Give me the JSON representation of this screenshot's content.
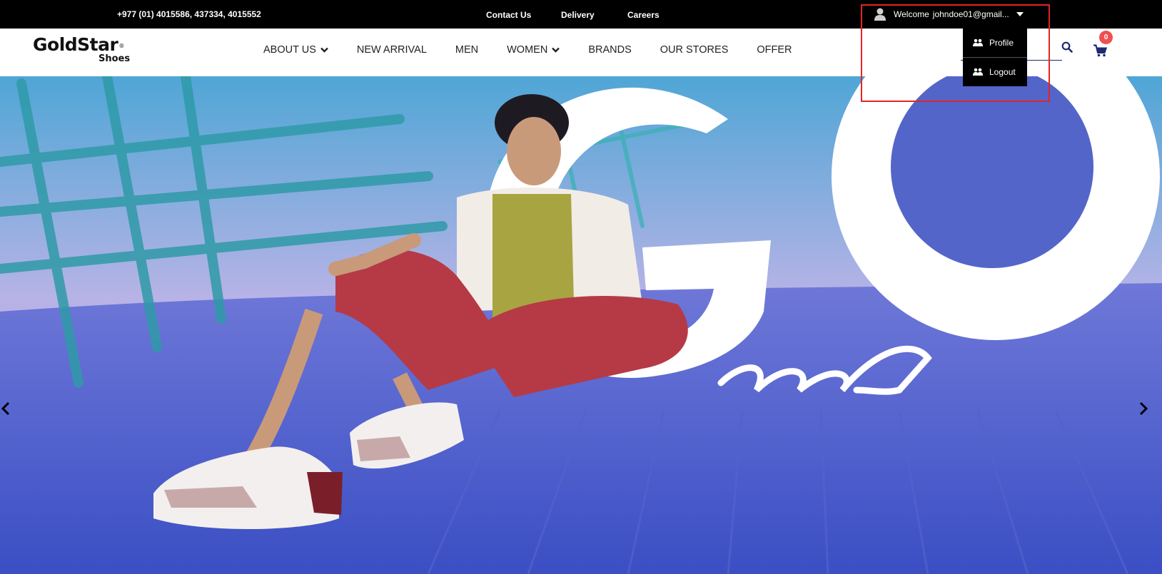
{
  "topbar": {
    "phone": "+977 (01) 4015586, 437334, 4015552",
    "links": [
      "Contact Us",
      "Delivery",
      "Careers"
    ],
    "welcome_label": "Welcome",
    "user_email": "johndoe01@gmail..."
  },
  "logo": {
    "line1": "GoldStar",
    "line2": "Shoes",
    "registered": "®"
  },
  "nav": {
    "items": [
      "ABOUT US",
      "NEW ARRIVAL",
      "MEN",
      "WOMEN",
      "BRANDS",
      "OUR STORES",
      "OFFER"
    ]
  },
  "cart": {
    "count": "0"
  },
  "user_menu": {
    "items": [
      "Profile",
      "Logout"
    ]
  },
  "colors": {
    "topbar_bg": "#000000",
    "badge": "#f0504f",
    "highlight": "#e32525",
    "nav_accent": "#1e2a6d"
  },
  "icons": [
    "user-icon",
    "caret-down-icon",
    "chevron-down-icon",
    "search-icon",
    "cart-icon",
    "users-icon",
    "arrow-left-icon",
    "arrow-right-icon"
  ]
}
